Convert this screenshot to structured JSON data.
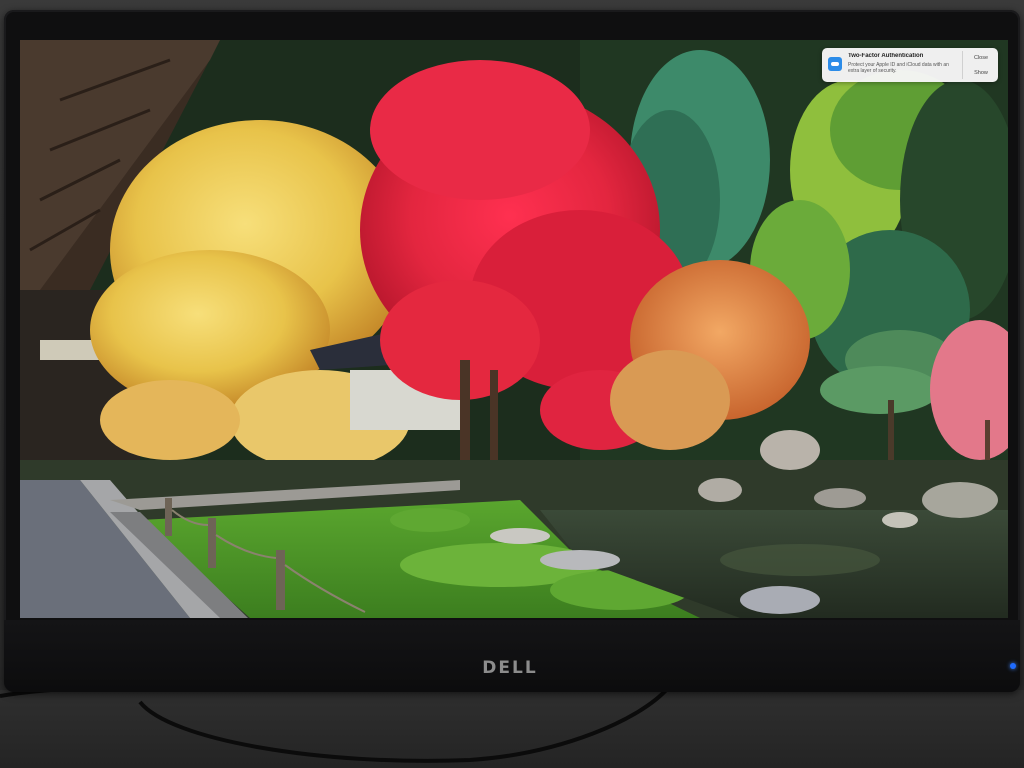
{
  "monitor": {
    "brand_logo": "DELL"
  },
  "wallpaper": {
    "description_icon": "japanese-garden-wallpaper"
  },
  "notification": {
    "icon": "icloud-icon",
    "title": "Two-Factor Authentication",
    "body": "Protect your Apple ID and iCloud data with an extra layer of security.",
    "close_label": "Close",
    "show_label": "Show"
  },
  "colors": {
    "maple_red": "#e3263f",
    "foliage_yellow": "#e8c34a",
    "grass_green": "#4f9a2a",
    "pond": "#2d3a2b",
    "led_blue": "#1f6bff"
  }
}
